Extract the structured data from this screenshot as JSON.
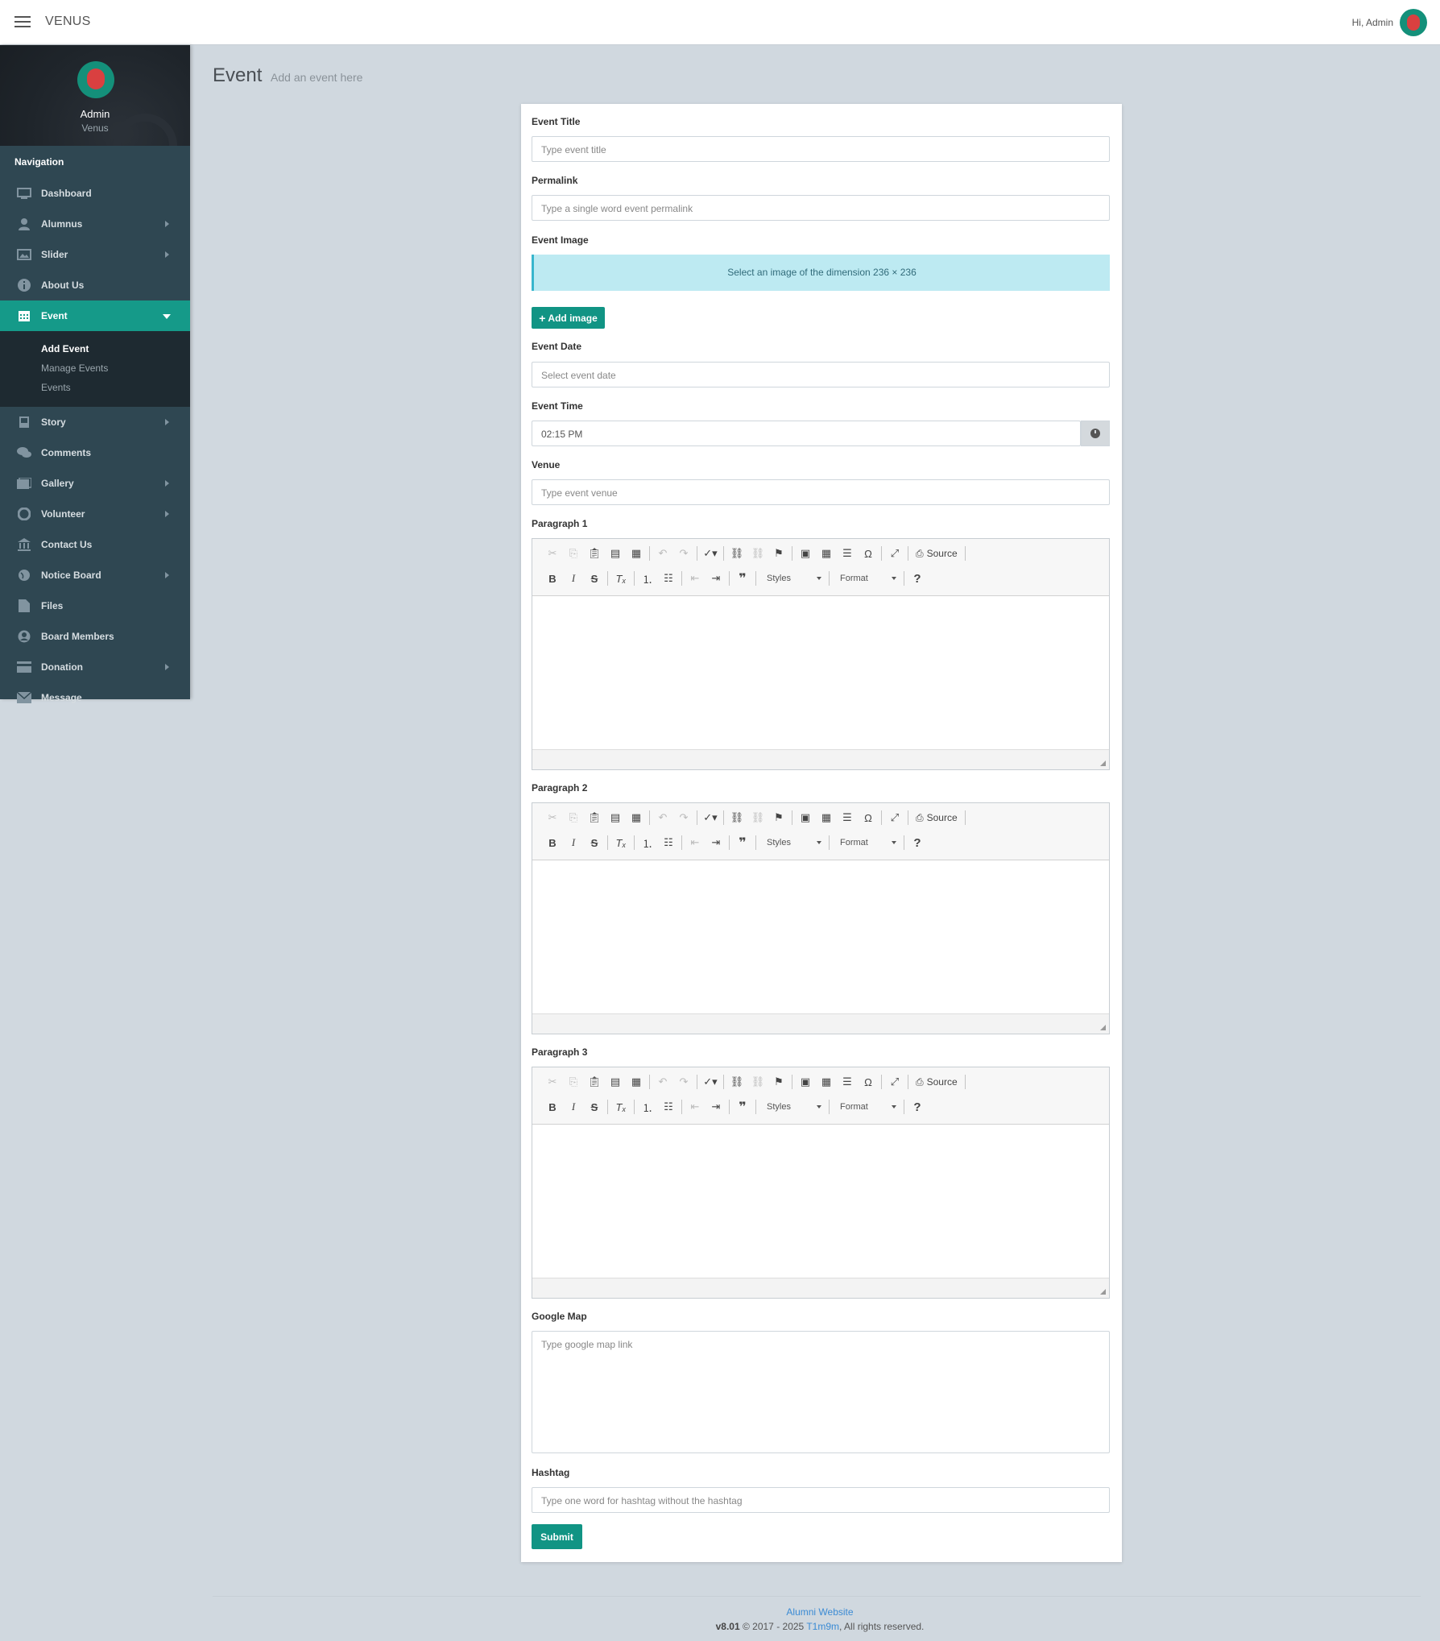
{
  "header": {
    "brand": "VENUS",
    "greeting": "Hi, Admin"
  },
  "sidebar": {
    "profile_name": "Admin",
    "profile_sub": "Venus",
    "nav_title": "Navigation",
    "items": [
      {
        "label": "Dashboard",
        "icon": "monitor-icon"
      },
      {
        "label": "Alumnus",
        "icon": "user-icon"
      },
      {
        "label": "Slider",
        "icon": "image-icon"
      },
      {
        "label": "About Us",
        "icon": "info-icon"
      },
      {
        "label": "Event",
        "icon": "calendar-icon"
      },
      {
        "label": "Story",
        "icon": "book-icon"
      },
      {
        "label": "Comments",
        "icon": "comments-icon"
      },
      {
        "label": "Gallery",
        "icon": "gallery-icon"
      },
      {
        "label": "Volunteer",
        "icon": "lifebuoy-icon"
      },
      {
        "label": "Contact Us",
        "icon": "bank-icon"
      },
      {
        "label": "Notice Board",
        "icon": "globe-icon"
      },
      {
        "label": "Files",
        "icon": "file-icon"
      },
      {
        "label": "Board Members",
        "icon": "user-circle-icon"
      },
      {
        "label": "Donation",
        "icon": "credit-card-icon"
      },
      {
        "label": "Message",
        "icon": "envelope-icon"
      }
    ],
    "event_sub": [
      "Add Event",
      "Manage Events",
      "Events"
    ]
  },
  "page": {
    "title": "Event",
    "subtitle": "Add an event here"
  },
  "form": {
    "title_label": "Event Title",
    "title_placeholder": "Type event title",
    "permalink_label": "Permalink",
    "permalink_placeholder": "Type a single word event permalink",
    "image_label": "Event Image",
    "image_info": "Select an image of the dimension 236 × 236",
    "add_image": "Add image",
    "date_label": "Event Date",
    "date_placeholder": "Select event date",
    "time_label": "Event Time",
    "time_value": "02:15 PM",
    "venue_label": "Venue",
    "venue_placeholder": "Type event venue",
    "p1_label": "Paragraph 1",
    "p2_label": "Paragraph 2",
    "p3_label": "Paragraph 3",
    "map_label": "Google Map",
    "map_placeholder": "Type google map link",
    "hashtag_label": "Hashtag",
    "hashtag_placeholder": "Type one word for hashtag without the hashtag",
    "submit": "Submit"
  },
  "editor": {
    "source": "Source",
    "styles": "Styles",
    "format": "Format"
  },
  "footer": {
    "site": "Alumni Website",
    "version": "v8.01",
    "copyright": "© 2017 - 2025",
    "author": "T1m9m",
    "rights": ", All rights reserved."
  },
  "colors": {
    "accent": "#119484",
    "sidebar": "#2f4752",
    "background": "#d0d8df",
    "info": "#bdeaf2"
  }
}
